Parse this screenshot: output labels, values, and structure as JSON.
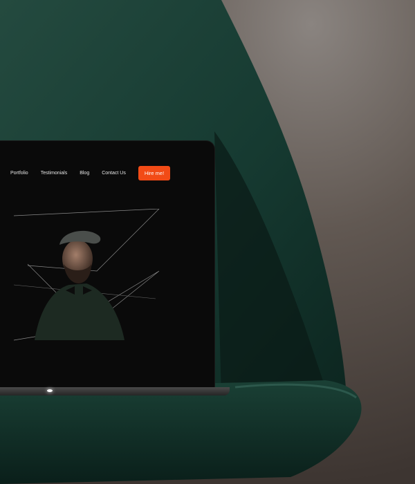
{
  "nav": {
    "items": [
      "Portfolio",
      "Testimonials",
      "Blog",
      "Contact Us"
    ],
    "cta_label": "Hire me!"
  },
  "icons": {
    "scroll": "arrow-down-icon"
  },
  "colors": {
    "accent": "#f24b16",
    "chair": "#183a31",
    "wall": "#5a524d",
    "screen": "#0a0a0a"
  }
}
